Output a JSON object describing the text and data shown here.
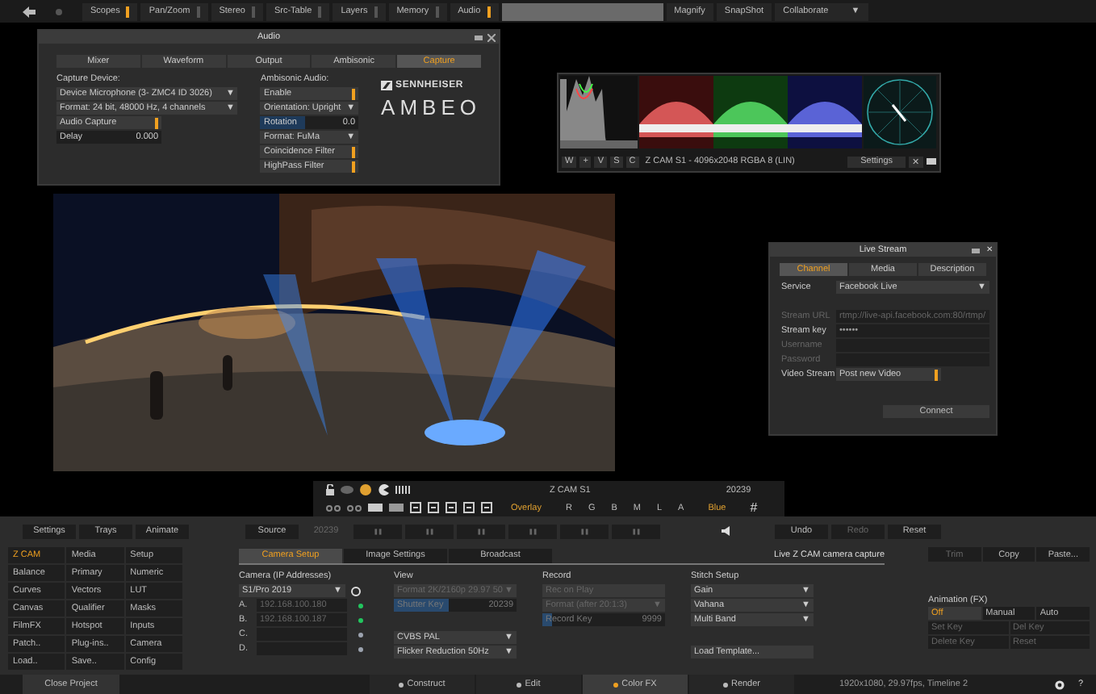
{
  "top_bar": {
    "tabs": [
      {
        "label": "Scopes",
        "on": true
      },
      {
        "label": "Pan/Zoom",
        "on": false
      },
      {
        "label": "Stereo",
        "on": false
      },
      {
        "label": "Src-Table",
        "on": false
      },
      {
        "label": "Layers",
        "on": false
      },
      {
        "label": "Memory",
        "on": false
      },
      {
        "label": "Audio",
        "on": true
      }
    ],
    "tools": [
      {
        "label": "Magnify"
      },
      {
        "label": "SnapShot"
      },
      {
        "label": "Collaborate",
        "caret": "▼"
      }
    ]
  },
  "audio_window": {
    "title": "Audio",
    "tabs": [
      {
        "label": "Mixer",
        "selected": false
      },
      {
        "label": "Waveform",
        "selected": false
      },
      {
        "label": "Output",
        "selected": false
      },
      {
        "label": "Ambisonic",
        "selected": false
      },
      {
        "label": "Capture",
        "selected": true
      }
    ],
    "capture": {
      "heading": "Capture Device:",
      "device": "Device Microphone (3- ZMC4 ID 3026)",
      "format": "Format: 24 bit, 48000 Hz, 4 channels",
      "caret": "▼",
      "audio_capture": {
        "label": "Audio Capture",
        "on": true
      },
      "delay": {
        "label": "Delay",
        "value": "0.000"
      }
    },
    "ambisonic": {
      "heading": "Ambisonic Audio:",
      "rows": [
        {
          "kind": "toggle",
          "label": "Enable",
          "on": true
        },
        {
          "kind": "dropdown",
          "label": "Orientation: Upright"
        },
        {
          "kind": "number",
          "label": "Rotation",
          "value": "0.0",
          "level": 0.45
        },
        {
          "kind": "dropdown",
          "label": "Format: FuMa"
        },
        {
          "kind": "toggle",
          "label": "Coincidence Filter",
          "on": true
        },
        {
          "kind": "toggle",
          "label": "HighPass Filter",
          "on": true
        }
      ]
    },
    "logo": {
      "brand": "SENNHEISER",
      "product": "AMBEO"
    }
  },
  "scopes": {
    "buttons": [
      "W",
      "+",
      "V",
      "S",
      "C"
    ],
    "caption": "Z CAM S1 - 4096x2048 RGBA 8 (LIN)",
    "settings": "Settings",
    "close": "✕"
  },
  "live_stream": {
    "title": "Live Stream",
    "close": "✕",
    "tabs": [
      {
        "label": "Channel",
        "selected": true
      },
      {
        "label": "Media",
        "selected": false
      },
      {
        "label": "Description",
        "selected": false
      }
    ],
    "fields": [
      {
        "kind": "dropdown",
        "label": "Service",
        "value": "Facebook Live",
        "disabled": false
      },
      {
        "kind": "text",
        "label": "Stream URL",
        "value": "rtmp://live-api.facebook.com:80/rtmp/",
        "disabled": true
      },
      {
        "kind": "text",
        "label": "Stream key",
        "value": "••••••",
        "disabled": false
      },
      {
        "kind": "text",
        "label": "Username",
        "disabled": true
      },
      {
        "kind": "text",
        "label": "Password",
        "disabled": true
      },
      {
        "kind": "toggle",
        "label": "Video Stream",
        "value": "Post new Video",
        "on": true,
        "disabled": false
      }
    ],
    "connect": "Connect"
  },
  "viewer_toolbar": {
    "clip": "Z CAM S1",
    "frame": "20239",
    "overlay": "Overlay",
    "channels": [
      "R",
      "G",
      "B",
      "M",
      "L",
      "A"
    ],
    "channel_view": "Blue",
    "grid": "#"
  },
  "panel": {
    "trays": [
      "Settings",
      "Trays",
      "Animate"
    ],
    "source": "Source",
    "frame": "20239",
    "history": [
      {
        "label": "Undo",
        "disabled": false
      },
      {
        "label": "Redo",
        "disabled": true
      },
      {
        "label": "Reset",
        "disabled": false
      }
    ],
    "menu": [
      {
        "label": "Z CAM",
        "selected": true
      },
      {
        "label": "Media",
        "selected": false
      },
      {
        "label": "Setup",
        "selected": false
      },
      {
        "label": "Balance",
        "selected": false
      },
      {
        "label": "Primary",
        "selected": false
      },
      {
        "label": "Numeric",
        "selected": false
      },
      {
        "label": "Curves",
        "selected": false
      },
      {
        "label": "Vectors",
        "selected": false
      },
      {
        "label": "LUT",
        "selected": false
      },
      {
        "label": "Canvas",
        "selected": false
      },
      {
        "label": "Qualifier",
        "selected": false
      },
      {
        "label": "Masks",
        "selected": false
      },
      {
        "label": "FilmFX",
        "selected": false
      },
      {
        "label": "Hotspot",
        "selected": false
      },
      {
        "label": "Inputs",
        "selected": false
      },
      {
        "label": "Patch..",
        "selected": false
      },
      {
        "label": "Plug-ins..",
        "selected": false
      },
      {
        "label": "Camera",
        "selected": false
      },
      {
        "label": "Load..",
        "selected": false
      },
      {
        "label": "Save..",
        "selected": false
      },
      {
        "label": "Config",
        "selected": false
      }
    ],
    "tabs": [
      {
        "label": "Camera Setup",
        "selected": true
      },
      {
        "label": "Image Settings",
        "selected": false
      },
      {
        "label": "Broadcast",
        "selected": false
      }
    ],
    "caption": "Live Z CAM camera capture",
    "camera": {
      "heading": "Camera (IP Addresses)",
      "model": "S1/Pro 2019",
      "slots": [
        {
          "letter": "A.",
          "ip": "192.168.100.180",
          "color": "#22c55e"
        },
        {
          "letter": "B.",
          "ip": "192.168.100.187",
          "color": "#22c55e"
        },
        {
          "letter": "C.",
          "color": "#9ca3af"
        },
        {
          "letter": "D.",
          "color": "#9ca3af"
        }
      ]
    },
    "view": {
      "heading": "View",
      "format": "Format 2K/2160p 29.97 50",
      "key": {
        "label": "Shutter Key",
        "value": "20239",
        "level": 0.45
      },
      "standard": "CVBS PAL",
      "flicker": "Flicker Reduction 50Hz"
    },
    "record": {
      "heading": "Record",
      "rec": "Rec on Play",
      "format": "Format (after 20:1:3)",
      "key": {
        "label": "Record Key",
        "value": "9999",
        "level": 0.08
      }
    },
    "stitch": {
      "heading": "Stitch Setup",
      "options": [
        "Gain",
        "Vahana",
        "Multi Band"
      ],
      "template": "Load Template..."
    },
    "clipboard": [
      {
        "label": "Trim",
        "disabled": true
      },
      {
        "label": "Copy",
        "disabled": false
      },
      {
        "label": "Paste...",
        "disabled": false
      }
    ],
    "animation": {
      "heading": "Animation (FX)",
      "modes": [
        {
          "label": "Off",
          "selected": true
        },
        {
          "label": "Manual",
          "selected": false
        },
        {
          "label": "Auto",
          "selected": false
        }
      ],
      "keys": [
        "Set Key",
        "Del Key",
        "Delete Key",
        "Reset"
      ]
    }
  },
  "status_bar": {
    "close": "Close Project",
    "modes": [
      {
        "label": "Construct",
        "selected": false
      },
      {
        "label": "Edit",
        "selected": false
      },
      {
        "label": "Color FX",
        "selected": true
      },
      {
        "label": "Render",
        "selected": false
      }
    ],
    "info": "1920x1080, 29.97fps, Timeline 2",
    "help": "?"
  }
}
